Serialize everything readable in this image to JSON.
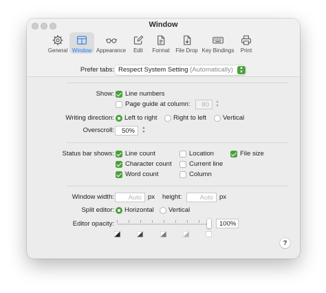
{
  "window": {
    "title": "Window"
  },
  "toolbar": {
    "items": [
      {
        "label": "General",
        "icon": "gear-icon"
      },
      {
        "label": "Window",
        "icon": "window-icon",
        "selected": true
      },
      {
        "label": "Appearance",
        "icon": "glasses-icon"
      },
      {
        "label": "Edit",
        "icon": "pencil-square-icon"
      },
      {
        "label": "Format",
        "icon": "document-icon"
      },
      {
        "label": "File Drop",
        "icon": "document-arrow-icon"
      },
      {
        "label": "Key Bindings",
        "icon": "keyboard-icon"
      },
      {
        "label": "Print",
        "icon": "printer-icon"
      }
    ]
  },
  "tabs": {
    "label": "Prefer tabs:",
    "value": "Respect System Setting",
    "value_note": "(Automatically)"
  },
  "show": {
    "label": "Show:",
    "line_numbers": {
      "label": "Line numbers",
      "checked": true
    },
    "page_guide": {
      "label": "Page guide at column:",
      "checked": false,
      "value": "80"
    }
  },
  "writing_direction": {
    "label": "Writing direction:",
    "options": [
      {
        "label": "Left to right",
        "selected": true
      },
      {
        "label": "Right to left",
        "selected": false
      },
      {
        "label": "Vertical",
        "selected": false
      }
    ]
  },
  "overscroll": {
    "label": "Overscroll:",
    "value": "50%"
  },
  "status_bar": {
    "label": "Status bar shows:",
    "items": [
      {
        "label": "Line count",
        "checked": true
      },
      {
        "label": "Location",
        "checked": false
      },
      {
        "label": "File size",
        "checked": true
      },
      {
        "label": "Character count",
        "checked": true
      },
      {
        "label": "Current line",
        "checked": false
      },
      {
        "label": "Word count",
        "checked": true
      },
      {
        "label": "Column",
        "checked": false
      }
    ]
  },
  "window_size": {
    "width_label": "Window width:",
    "width_placeholder": "Auto",
    "height_label": "height:",
    "height_placeholder": "Auto",
    "unit": "px"
  },
  "split_editor": {
    "label": "Split editor:",
    "options": [
      {
        "label": "Horizontal",
        "selected": true
      },
      {
        "label": "Vertical",
        "selected": false
      }
    ]
  },
  "opacity": {
    "label": "Editor opacity:",
    "value": "100%",
    "level": 1.0
  },
  "colors": {
    "accent": "#4aa13b",
    "selected_tab": "#1f7ef0"
  }
}
